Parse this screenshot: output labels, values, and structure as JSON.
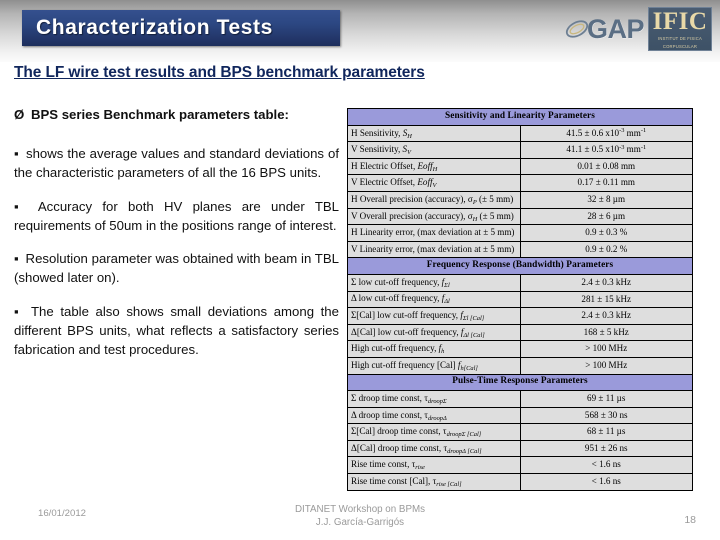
{
  "slide": {
    "title": "Characterization Tests",
    "subtitle": "The LF wire test results and BPS benchmark parameters",
    "brand": {
      "gap_text": "GAP",
      "ific_text": "IFIC",
      "ific_sub_line1": "INSTITUT DE FISICA",
      "ific_sub_line2": "CORPUSCULAR"
    },
    "accent_title_bg": "#2c4782",
    "accent_subtitle": "#10265c",
    "accent_section_bg": "#9a9ada",
    "cell_bg": "#dedede"
  },
  "body": {
    "lead_bullet": "Ø",
    "lead_text": "BPS series Benchmark parameters table:",
    "bullets": [
      {
        "mark": "▪",
        "text": "shows the average values and standard deviations of the characteristic parameters of all the 16 BPS units."
      },
      {
        "mark": "▪",
        "text": "Accuracy for both HV planes are under TBL requirements of 50um in the positions range of interest."
      },
      {
        "mark": "▪",
        "text": "Resolution parameter was obtained with beam in TBL (showed later on)."
      },
      {
        "mark": "▪",
        "text": "The table also shows small deviations among the different BPS units, what reflects a satisfactory series fabrication and test procedures."
      }
    ]
  },
  "table": {
    "sections": [
      {
        "header": "Sensitivity and Linearity Parameters",
        "rows": [
          {
            "label_html": "H Sensitivity, <i>S</i><sub>H</sub>",
            "value_html": "41.5 ± 0.6  x10<sup>-3</sup> mm<sup>-1</sup>"
          },
          {
            "label_html": "V Sensitivity, <i>S</i><sub>V</sub>",
            "value_html": "41.1 ± 0.5  x10<sup>-3</sup> mm<sup>-1</sup>"
          },
          {
            "label_html": "H Electric Offset, <i>Eoff</i><sub>H</sub>",
            "value_html": "0.01 ± 0.08 mm"
          },
          {
            "label_html": "V Electric Offset, <i>Eoff</i><sub>V</sub>",
            "value_html": "0.17 ± 0.11 mm"
          },
          {
            "label_html": "H Overall precision (accuracy), σ<sub>P</sub>  (± 5 mm)",
            "value_html": "32 ± 8 µm"
          },
          {
            "label_html": "V Overall precision (accuracy), σ<sub>H</sub>  (± 5 mm)",
            "value_html": "28 ± 6 µm"
          },
          {
            "label_html": "H Linearity error, (max deviation at ± 5 mm)",
            "value_html": "0.9 ± 0.3 %"
          },
          {
            "label_html": "V Linearity error, (max deviation at ± 5 mm)",
            "value_html": "0.9 ± 0.2 %"
          }
        ]
      },
      {
        "header": "Frequency Response (Bandwidth) Parameters",
        "rows": [
          {
            "label_html": "Σ low cut-off frequency, <i>f</i><sub>Σl</sub>",
            "value_html": "2.4 ± 0.3 kHz"
          },
          {
            "label_html": "Δ low cut-off frequency, <i>f</i><sub>Δl</sub>",
            "value_html": "281 ± 15 kHz"
          },
          {
            "label_html": "Σ[Cal] low cut-off frequency, <i>f</i><sub>Σl [Cal]</sub>",
            "value_html": "2.4 ± 0.3 kHz"
          },
          {
            "label_html": "Δ[Cal] low cut-off frequency, <i>f</i><sub>Δl [Cal]</sub>",
            "value_html": "168 ± 5 kHz"
          },
          {
            "label_html": "High cut-off frequency, <i>f</i><sub>h</sub>",
            "value_html": "> 100 MHz"
          },
          {
            "label_html": "High cut-off frequency [Cal] <i>f</i><sub>h[Cal]</sub>",
            "value_html": "> 100 MHz"
          }
        ]
      },
      {
        "header": "Pulse-Time Response Parameters",
        "rows": [
          {
            "label_html": "Σ droop time const, τ<sub>droopΣ</sub>",
            "value_html": "69 ± 11 µs"
          },
          {
            "label_html": "Δ droop time const, τ<sub>droopΔ</sub>",
            "value_html": "568 ± 30 ns"
          },
          {
            "label_html": "Σ[Cal] droop time const, τ<sub>droopΣ [Cal]</sub>",
            "value_html": "68 ± 11 µs"
          },
          {
            "label_html": "Δ[Cal] droop time const, τ<sub>droopΔ [Cal]</sub>",
            "value_html": "951 ± 26 ns"
          },
          {
            "label_html": "Rise time const, τ<sub>rise</sub>",
            "value_html": "< 1.6 ns"
          },
          {
            "label_html": "Rise time const [Cal], τ<sub>rise [Cal]</sub>",
            "value_html": "< 1.6 ns"
          }
        ]
      }
    ]
  },
  "footer": {
    "date": "16/01/2012",
    "center_line1": "DITANET Workshop on BPMs",
    "center_line2": "J.J. García-Garrigós",
    "page": "18"
  }
}
